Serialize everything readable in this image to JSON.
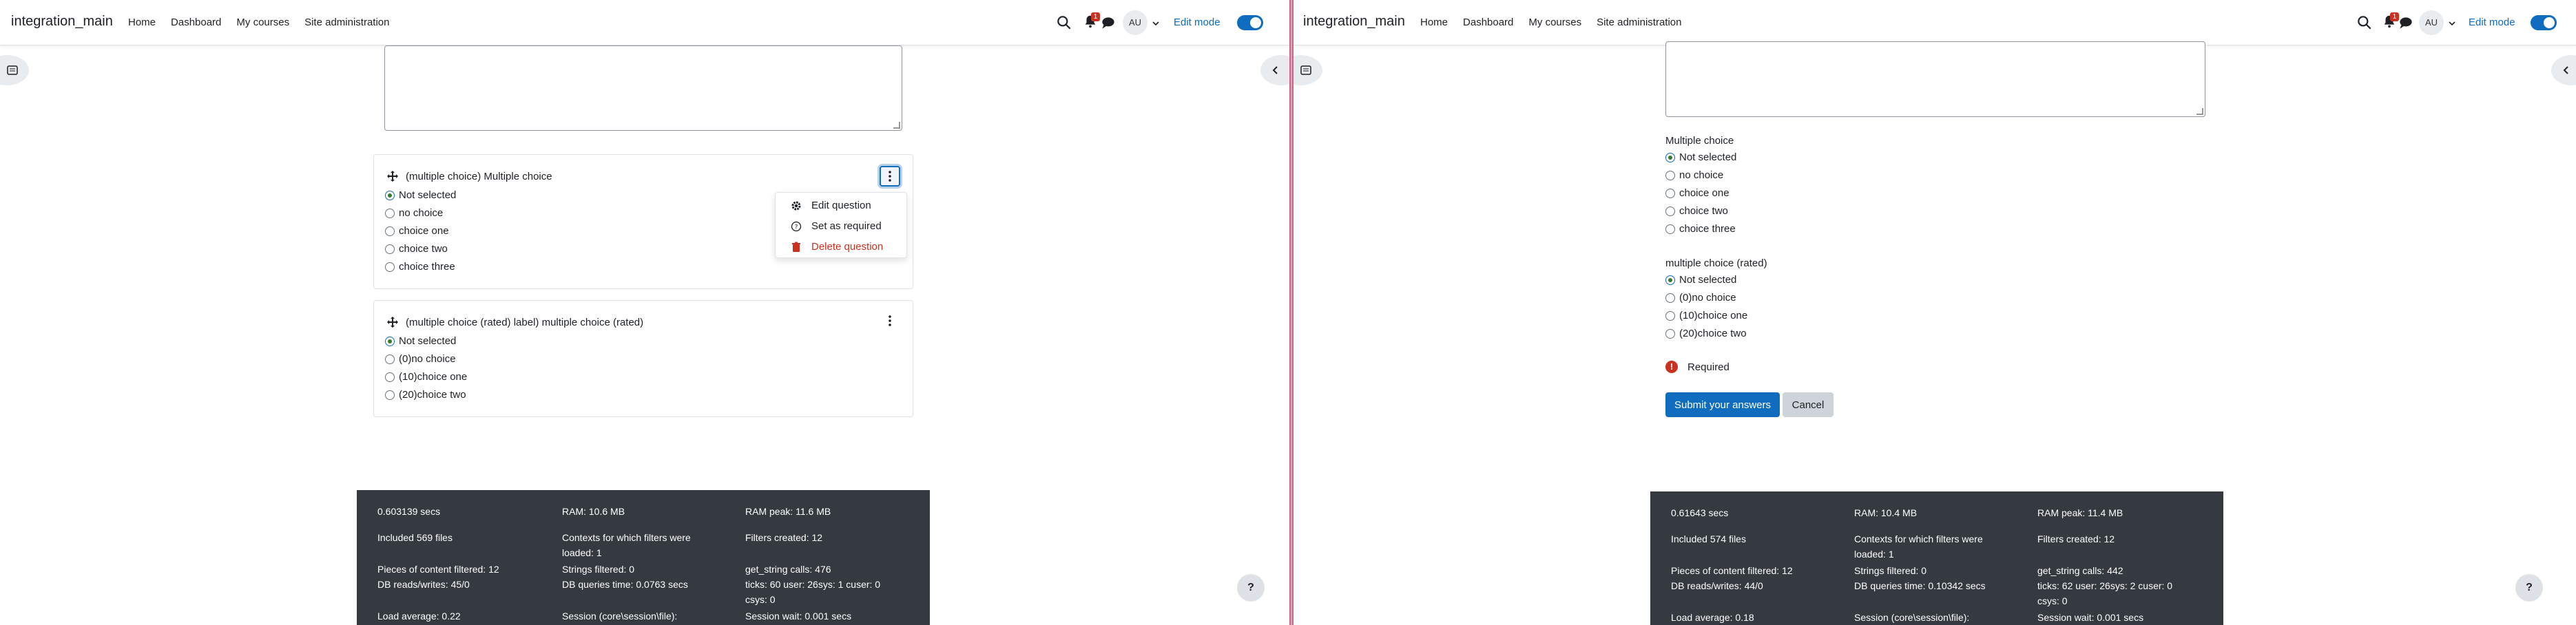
{
  "left": {
    "brand": "integration_main",
    "nav": [
      "Home",
      "Dashboard",
      "My courses",
      "Site administration"
    ],
    "notification_count": "1",
    "avatar_initials": "AU",
    "edit_mode_label": "Edit mode",
    "question1": {
      "title": "(multiple choice) Multiple choice",
      "options": [
        "Not selected",
        "no choice",
        "choice one",
        "choice two",
        "choice three"
      ],
      "selected_index": 0
    },
    "action_menu": {
      "items": [
        {
          "label": "Edit question",
          "icon": "gear-icon"
        },
        {
          "label": "Set as required",
          "icon": "question-circle-icon"
        },
        {
          "label": "Delete question",
          "icon": "trash-icon"
        }
      ]
    },
    "question2": {
      "title": "(multiple choice (rated) label) multiple choice (rated)",
      "options": [
        "Not selected",
        "(0)no choice",
        "(10)choice one",
        "(20)choice two"
      ],
      "selected_index": 0
    },
    "footer": {
      "col1": [
        "0.603139 secs",
        "Included 569 files",
        "Pieces of content filtered: 12",
        "DB reads/writes: 45/0",
        "Load average: 0.22"
      ],
      "col2": [
        "RAM: 10.6 MB",
        "Contexts for which filters were loaded: 1",
        "Strings filtered: 0",
        "DB queries time: 0.0763 secs",
        "Session (core\\session\\file):"
      ],
      "col3": [
        "RAM peak: 11.6 MB",
        "Filters created: 12",
        "get_string calls: 476",
        "ticks: 60 user: 26sys: 1 cuser: 0 csys: 0",
        "Session wait: 0.001 secs"
      ]
    },
    "help_label": "?"
  },
  "right": {
    "brand": "integration_main",
    "nav": [
      "Home",
      "Dashboard",
      "My courses",
      "Site administration"
    ],
    "notification_count": "1",
    "avatar_initials": "AU",
    "edit_mode_label": "Edit mode",
    "question1": {
      "label": "Multiple choice",
      "options": [
        "Not selected",
        "no choice",
        "choice one",
        "choice two",
        "choice three"
      ],
      "selected_index": 0
    },
    "question2": {
      "label": "multiple choice (rated)",
      "options": [
        "Not selected",
        "(0)no choice",
        "(10)choice one",
        "(20)choice two"
      ],
      "selected_index": 0
    },
    "required_label": "Required",
    "submit_label": "Submit your answers",
    "cancel_label": "Cancel",
    "footer": {
      "col1": [
        "0.61643 secs",
        "Included 574 files",
        "Pieces of content filtered: 12",
        "DB reads/writes: 44/0",
        "Load average: 0.18"
      ],
      "col2": [
        "RAM: 10.4 MB",
        "Contexts for which filters were loaded: 1",
        "Strings filtered: 0",
        "DB queries time: 0.10342 secs",
        "Session (core\\session\\file):"
      ],
      "col3": [
        "RAM peak: 11.4 MB",
        "Filters created: 12",
        "get_string calls: 442",
        "ticks: 62 user: 26sys: 2 cuser: 0 csys: 0",
        "Session wait: 0.001 secs"
      ]
    },
    "help_label": "?"
  },
  "colors": {
    "primary": "#0f6cbf",
    "danger": "#ca3120",
    "success": "#357a32",
    "footer_bg": "#343a40",
    "divider": "#c8688a"
  }
}
